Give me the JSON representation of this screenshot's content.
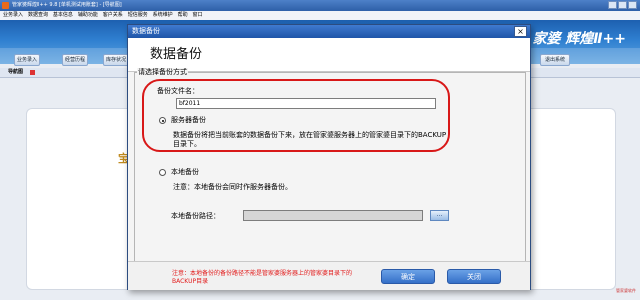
{
  "app": {
    "title": "管家婆辉煌Ⅱ++ 9.8 [单机测试用账套] - [导航图]",
    "menu": [
      "业务录入",
      "数据查询",
      "基本信息",
      "辅助功能",
      "客户关系",
      "短信服务",
      "系统维护",
      "帮助",
      "窗口"
    ],
    "brand": "家婆 辉煌Ⅱ++",
    "nav_buttons": [
      "业务录入",
      "经营历程",
      "库存状况",
      "退出系统"
    ],
    "guide_title": "导航图",
    "bg_fragment": "宝",
    "corner_text": "管家婆软件"
  },
  "dialog": {
    "window_title": "数据备份",
    "close_glyph": "×",
    "heading": "数据备份",
    "group_label": "请选择备份方式",
    "filename_label": "备份文件名：",
    "filename_value": "bf2011",
    "server_option": "服务器备份",
    "server_desc": "数据备份将把当前账套的数据备份下来，放在管家婆服务器上的管家婆目录下的BACKUP目录下。",
    "local_option": "本地备份",
    "local_note": "注意：本地备份会同时作服务器备份。",
    "local_path_label": "本地备份路径：",
    "local_path_value": "",
    "browse_label": "...",
    "warning": "注意：本地备份的备份路径不能是管家婆服务器上的管家婆目录下的BACKUP目录",
    "ok_label": "确定",
    "close_label": "关闭"
  },
  "colors": {
    "title_blue": "#1e55a8",
    "button_blue": "#3570c8",
    "highlight_red": "#d81818",
    "warning_red": "#e21a1a"
  },
  "state": {
    "selected_mode": "server"
  }
}
